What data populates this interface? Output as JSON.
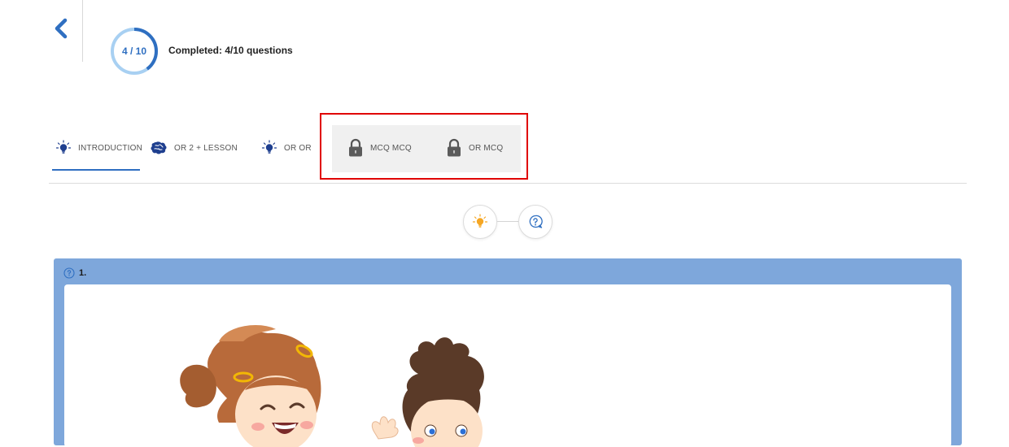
{
  "header": {
    "back_icon": "chevron-left-icon",
    "progress": {
      "text": "4 / 10",
      "completed": 4,
      "total": 10,
      "label": "Completed: 4/10 questions"
    }
  },
  "tabs": [
    {
      "label": "INTRODUCTION",
      "icon": "lightbulb-icon",
      "active": true,
      "locked": false
    },
    {
      "label": "OR 2 + LESSON",
      "icon": "brain-icon",
      "active": false,
      "locked": false
    },
    {
      "label": "OR OR",
      "icon": "lightbulb-icon",
      "active": false,
      "locked": false
    },
    {
      "label": "MCQ MCQ",
      "icon": "lock-icon",
      "active": false,
      "locked": true
    },
    {
      "label": "OR MCQ",
      "icon": "lock-icon",
      "active": false,
      "locked": true
    }
  ],
  "steps": [
    {
      "icon": "lightbulb-icon",
      "color": "#f5a623"
    },
    {
      "icon": "question-chat-icon",
      "color": "#2f6fc1"
    }
  ],
  "question": {
    "number": "1.",
    "icon": "question-circle-icon",
    "image": "children-illustration"
  },
  "colors": {
    "accent": "#2f6fc1",
    "card": "#7ea7db",
    "highlight": "#e00000"
  }
}
